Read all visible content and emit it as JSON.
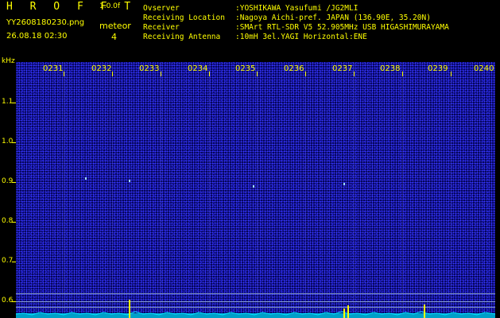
{
  "header": {
    "logo": "H R O F F T",
    "version": "1.0.0f",
    "filename": "YY2608180230.png",
    "timestamp": "26.08.18 02:30",
    "meteor_label": "meteor",
    "meteor_count": "4"
  },
  "info": [
    {
      "key": "Ovserver",
      "value": ":YOSHIKAWA Yasufumi /JG2MLI"
    },
    {
      "key": "Receiving Location",
      "value": ":Nagoya Aichi-pref. JAPAN (136.90E, 35.20N)"
    },
    {
      "key": "Receiver",
      "value": ":SMArt RTL-SDR V5 52.905MHz USB HIGASHIMURAYAMA"
    },
    {
      "key": "Receiving Antenna",
      "value": ":10mH 3el.YAGI Horizontal:ENE"
    }
  ],
  "axis": {
    "unit": "kHz",
    "y_ticks": [
      "1.1",
      "1.0",
      "0.9",
      "0.8",
      "0.7",
      "0.6"
    ],
    "x_ticks": [
      "0231",
      "0232",
      "0233",
      "0234",
      "0235",
      "0236",
      "0237",
      "0238",
      "0239",
      "0240"
    ]
  },
  "colors": {
    "text": "#FFFF00",
    "background": "#000000",
    "waterfall": "#00004a",
    "trace": "#00e5ff"
  }
}
